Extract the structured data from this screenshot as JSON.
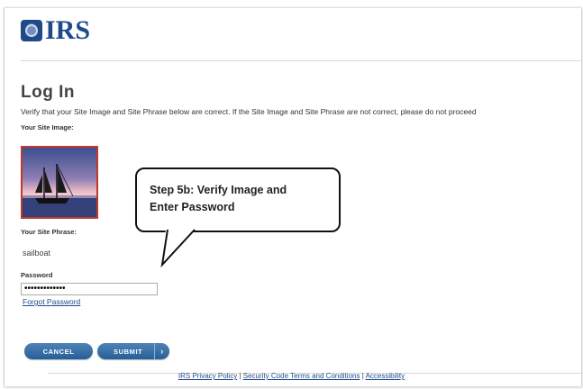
{
  "header": {
    "logo_text": "IRS",
    "logo_icon": "irs-seal-icon",
    "brand_color": "#1f4a8a"
  },
  "login": {
    "title": "Log In",
    "verify_text": "Verify that your Site Image and Site Phrase below are correct. If the Site Image and Site Phrase are not correct, please do not proceed",
    "site_image_label": "Your Site Image:",
    "site_image_description": "sailboat-at-sunset",
    "site_phrase_label": "Your Site Phrase:",
    "site_phrase": "sailboat",
    "password_label": "Password",
    "password_value": "•••••••••••••",
    "forgot_password": "Forgot Password"
  },
  "buttons": {
    "cancel": "CANCEL",
    "submit": "SUBMIT",
    "submit_chevron": "›",
    "button_color": "#255f97"
  },
  "callout": {
    "line1": "Step 5b:  Verify Image and",
    "line2": "Enter Password"
  },
  "footer": {
    "privacy": "IRS Privacy Policy",
    "security": "Security Code Terms and Conditions",
    "accessibility": "Accessibility",
    "separator": "|"
  }
}
